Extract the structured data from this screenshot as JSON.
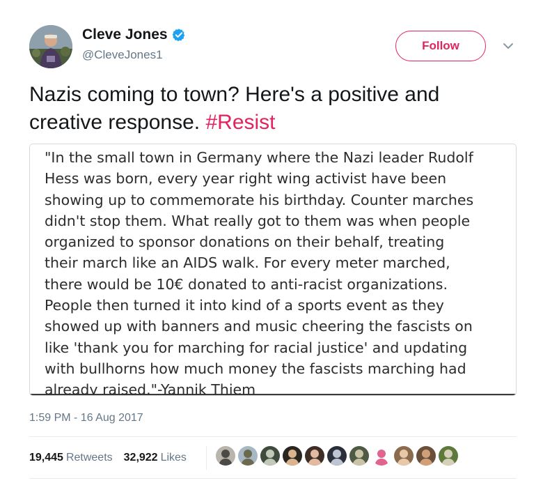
{
  "author": {
    "display_name": "Cleve Jones",
    "handle": "@CleveJones1",
    "verified": true
  },
  "follow_label": "Follow",
  "tweet": {
    "text": "Nazis coming to town? Here's a positive and creative response. ",
    "hashtag": "#Resist"
  },
  "media": {
    "quote_text": "\"In the small town in Germany where the Nazi leader Rudolf\nHess was born, every year right wing activist have been\nshowing up to commemorate his birthday. Counter marches\ndidn't stop them. What really got to them was when people\norganized to sponsor donations on their behalf, treating\ntheir march like an AIDS walk. For every meter marched,\nthere would be 10€ donated to anti-racist organizations.\nPeople then turned it into kind of a sports event as they\nshowed up with banners and music cheering the fascists on\nlike 'thank you for marching for racial justice' and updating\nwith bullhorns how much money the fascists marching had\nalready raised.\"-Yannik Thiem"
  },
  "timestamp": "1:59 PM - 16 Aug 2017",
  "stats": {
    "retweets_count": "19,445",
    "retweets_label": "Retweets",
    "likes_count": "32,922",
    "likes_label": "Likes"
  },
  "colors": {
    "accent": "#e0245e",
    "verified": "#1da1f2",
    "secondary_text": "#657786",
    "divider": "#e6ecf0"
  },
  "icons": {
    "verified": "verified-badge-icon",
    "chevron": "chevron-down-icon"
  },
  "liker_avatars": [
    {
      "bg": "#b9b5ad",
      "fg": "#4b4a47"
    },
    {
      "bg": "#a7b8c5",
      "fg": "#6b6a4e"
    },
    {
      "bg": "#3f4b3c",
      "fg": "#c2c9b8"
    },
    {
      "bg": "#2a2520",
      "fg": "#d9b48f"
    },
    {
      "bg": "#3d2f28",
      "fg": "#e3b9a1"
    },
    {
      "bg": "#2a2f3a",
      "fg": "#bfc4d4"
    },
    {
      "bg": "#4e5a44",
      "fg": "#c9c4a8"
    },
    {
      "bg": "#ffffff",
      "fg": "#e0648f"
    },
    {
      "bg": "#8a6b4e",
      "fg": "#e8c8a8"
    },
    {
      "bg": "#6a4f3b",
      "fg": "#d2a078"
    },
    {
      "bg": "#5d7a3c",
      "fg": "#d6d0b8"
    }
  ]
}
